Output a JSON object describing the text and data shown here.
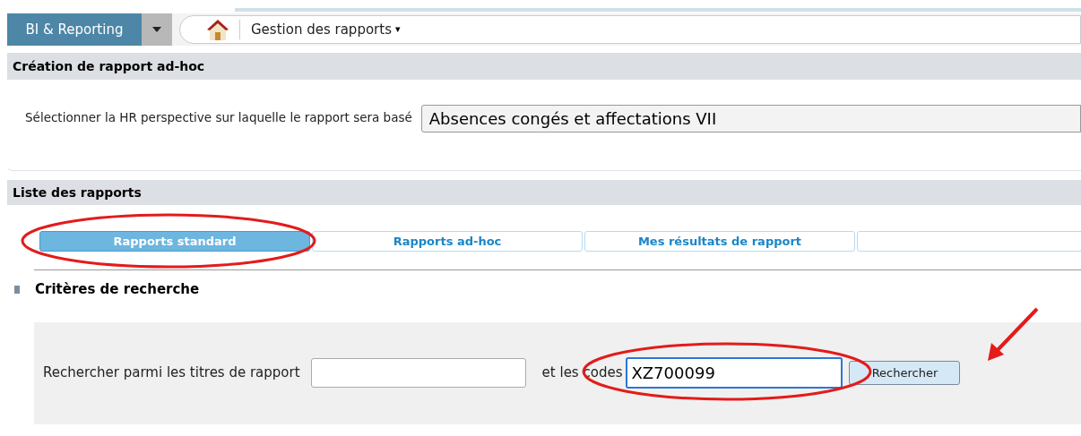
{
  "module_menu": {
    "label": "BI & Reporting"
  },
  "breadcrumb": {
    "label": "Gestion des rapports",
    "caret": "▾"
  },
  "adhoc_section": {
    "title": "Création de rapport ad-hoc",
    "prompt": "Sélectionner la HR perspective sur laquelle le rapport sera basé",
    "perspective": "Absences congés et affectations VII"
  },
  "list_section": {
    "title": "Liste des rapports"
  },
  "tabs": [
    {
      "label": "Rapports standard",
      "selected": true
    },
    {
      "label": "Rapports ad-hoc",
      "selected": false
    },
    {
      "label": "Mes résultats de rapport",
      "selected": false
    },
    {
      "selected": false
    }
  ],
  "criteria": {
    "title": "Critères de recherche",
    "title_label": "Rechercher parmi les titres de rapport",
    "codes_label": "et les codes",
    "codes_value": "XZ700099",
    "search_button": "Rechercher"
  }
}
